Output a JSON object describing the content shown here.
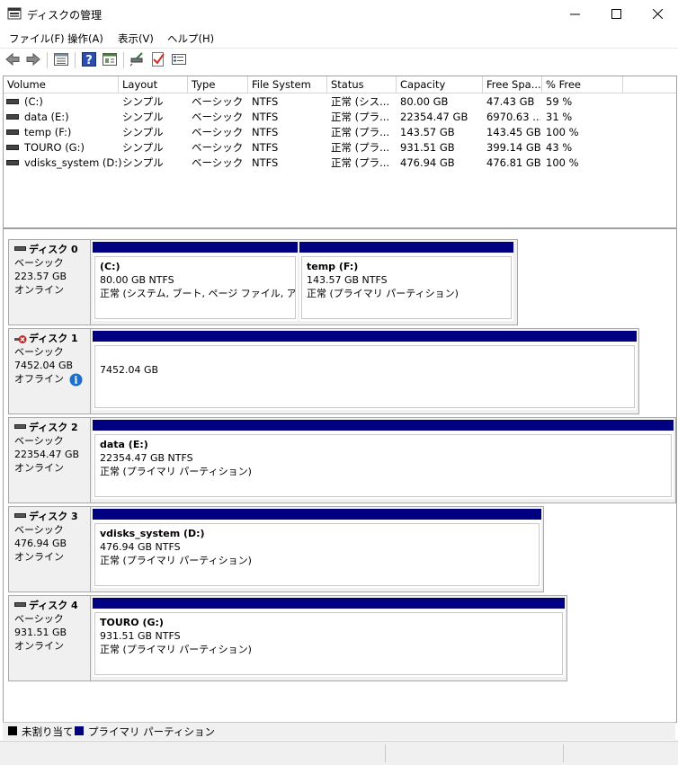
{
  "window": {
    "title": "ディスクの管理"
  },
  "menu": [
    "ファイル(F)",
    "操作(A)",
    "表示(V)",
    "ヘルプ(H)"
  ],
  "toolbar": {
    "icons": [
      "back-icon",
      "forward-icon",
      "list-view-icon",
      "help-icon",
      "properties-icon",
      "connect-icon",
      "check-icon",
      "settings-icon"
    ]
  },
  "volume_list": {
    "headers": [
      "Volume",
      "Layout",
      "Type",
      "File System",
      "Status",
      "Capacity",
      "Free Spa...",
      "% Free"
    ],
    "rows": [
      {
        "volume": "(C:)",
        "layout": "シンプル",
        "type": "ベーシック",
        "fs": "NTFS",
        "status": "正常 (シス...",
        "capacity": "80.00 GB",
        "free": "47.43 GB",
        "pct": "59 %"
      },
      {
        "volume": "data (E:)",
        "layout": "シンプル",
        "type": "ベーシック",
        "fs": "NTFS",
        "status": "正常 (プラ...",
        "capacity": "22354.47 GB",
        "free": "6970.63 ...",
        "pct": "31 %"
      },
      {
        "volume": "temp (F:)",
        "layout": "シンプル",
        "type": "ベーシック",
        "fs": "NTFS",
        "status": "正常 (プラ...",
        "capacity": "143.57 GB",
        "free": "143.45 GB",
        "pct": "100 %"
      },
      {
        "volume": "TOURO (G:)",
        "layout": "シンプル",
        "type": "ベーシック",
        "fs": "NTFS",
        "status": "正常 (プラ...",
        "capacity": "931.51 GB",
        "free": "399.14 GB",
        "pct": "43 %"
      },
      {
        "volume": "vdisks_system (D:)",
        "layout": "シンプル",
        "type": "ベーシック",
        "fs": "NTFS",
        "status": "正常 (プラ...",
        "capacity": "476.94 GB",
        "free": "476.81 GB",
        "pct": "100 %"
      }
    ]
  },
  "disks": [
    {
      "name": "ディスク 0",
      "type": "ベーシック",
      "size": "223.57 GB",
      "state": "オンライン",
      "partitions": [
        {
          "title": "(C:)",
          "size": "80.00 GB NTFS",
          "status": "正常 (システム, ブート, ページ ファイル, アクティブ"
        },
        {
          "title": "temp  (F:)",
          "size": "143.57 GB NTFS",
          "status": "正常 (プライマリ パーティション)"
        }
      ]
    },
    {
      "name": "ディスク 1",
      "type": "ベーシック",
      "size": "7452.04 GB",
      "state": "オフライン",
      "partitions": [
        {
          "title": "",
          "size": "7452.04 GB",
          "status": ""
        }
      ]
    },
    {
      "name": "ディスク 2",
      "type": "ベーシック",
      "size": "22354.47 GB",
      "state": "オンライン",
      "partitions": [
        {
          "title": "data  (E:)",
          "size": "22354.47 GB NTFS",
          "status": "正常 (プライマリ パーティション)"
        }
      ]
    },
    {
      "name": "ディスク 3",
      "type": "ベーシック",
      "size": "476.94 GB",
      "state": "オンライン",
      "partitions": [
        {
          "title": "vdisks_system  (D:)",
          "size": "476.94 GB NTFS",
          "status": "正常 (プライマリ パーティション)"
        }
      ]
    },
    {
      "name": "ディスク 4",
      "type": "ベーシック",
      "size": "931.51 GB",
      "state": "オンライン",
      "partitions": [
        {
          "title": "TOURO  (G:)",
          "size": "931.51 GB NTFS",
          "status": "正常 (プライマリ パーティション)"
        }
      ]
    }
  ],
  "legend": {
    "unallocated": "未割り当て",
    "primary": "プライマリ パーティション"
  },
  "colors": {
    "partition_bar": "#000080",
    "unallocated": "#000000"
  }
}
